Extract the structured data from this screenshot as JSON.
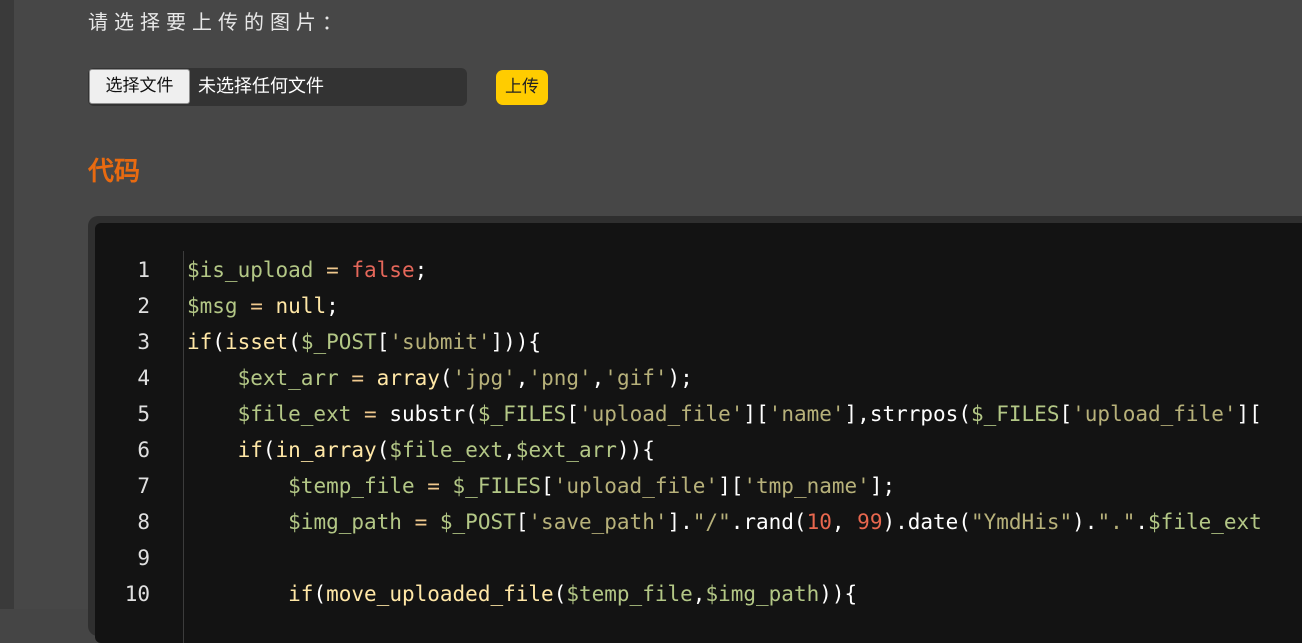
{
  "page": {
    "prompt": "请选择要上传的图片：",
    "section_title": "代码"
  },
  "file_input": {
    "button_label": "选择文件",
    "status_text": "未选择任何文件"
  },
  "upload_button": {
    "label": "上传"
  },
  "colors": {
    "accent_title": "#e86a10",
    "upload_button": "#ffcc00",
    "code_background": "#131313"
  },
  "code": {
    "line_numbers": [
      "1",
      "2",
      "3",
      "4",
      "5",
      "6",
      "7",
      "8",
      "9",
      "10"
    ],
    "lines": [
      [
        {
          "t": "var",
          "v": "$is_upload"
        },
        {
          "t": "op",
          "v": " = "
        },
        {
          "t": "bool",
          "v": "false"
        },
        {
          "t": "fn",
          "v": ";"
        }
      ],
      [
        {
          "t": "var",
          "v": "$msg"
        },
        {
          "t": "op",
          "v": " = "
        },
        {
          "t": "kw",
          "v": "null"
        },
        {
          "t": "fn",
          "v": ";"
        }
      ],
      [
        {
          "t": "kw",
          "v": "if"
        },
        {
          "t": "fn",
          "v": "("
        },
        {
          "t": "kw",
          "v": "isset"
        },
        {
          "t": "fn",
          "v": "("
        },
        {
          "t": "var",
          "v": "$_POST"
        },
        {
          "t": "fn",
          "v": "["
        },
        {
          "t": "str",
          "v": "'submit'"
        },
        {
          "t": "fn",
          "v": "])){"
        }
      ],
      [
        {
          "t": "fn",
          "v": "    "
        },
        {
          "t": "var",
          "v": "$ext_arr"
        },
        {
          "t": "op",
          "v": " = "
        },
        {
          "t": "kw",
          "v": "array"
        },
        {
          "t": "fn",
          "v": "("
        },
        {
          "t": "str",
          "v": "'jpg'"
        },
        {
          "t": "fn",
          "v": ","
        },
        {
          "t": "str",
          "v": "'png'"
        },
        {
          "t": "fn",
          "v": ","
        },
        {
          "t": "str",
          "v": "'gif'"
        },
        {
          "t": "fn",
          "v": ");"
        }
      ],
      [
        {
          "t": "fn",
          "v": "    "
        },
        {
          "t": "var",
          "v": "$file_ext"
        },
        {
          "t": "op",
          "v": " = "
        },
        {
          "t": "fn",
          "v": "substr("
        },
        {
          "t": "var",
          "v": "$_FILES"
        },
        {
          "t": "fn",
          "v": "["
        },
        {
          "t": "str",
          "v": "'upload_file'"
        },
        {
          "t": "fn",
          "v": "]["
        },
        {
          "t": "str",
          "v": "'name'"
        },
        {
          "t": "fn",
          "v": "],strrpos("
        },
        {
          "t": "var",
          "v": "$_FILES"
        },
        {
          "t": "fn",
          "v": "["
        },
        {
          "t": "str",
          "v": "'upload_file'"
        },
        {
          "t": "fn",
          "v": "]["
        }
      ],
      [
        {
          "t": "fn",
          "v": "    "
        },
        {
          "t": "kw",
          "v": "if"
        },
        {
          "t": "fn",
          "v": "("
        },
        {
          "t": "kw",
          "v": "in_array"
        },
        {
          "t": "fn",
          "v": "("
        },
        {
          "t": "var",
          "v": "$file_ext"
        },
        {
          "t": "fn",
          "v": ","
        },
        {
          "t": "var",
          "v": "$ext_arr"
        },
        {
          "t": "fn",
          "v": ")){"
        }
      ],
      [
        {
          "t": "fn",
          "v": "        "
        },
        {
          "t": "var",
          "v": "$temp_file"
        },
        {
          "t": "op",
          "v": " = "
        },
        {
          "t": "var",
          "v": "$_FILES"
        },
        {
          "t": "fn",
          "v": "["
        },
        {
          "t": "str",
          "v": "'upload_file'"
        },
        {
          "t": "fn",
          "v": "]["
        },
        {
          "t": "str",
          "v": "'tmp_name'"
        },
        {
          "t": "fn",
          "v": "];"
        }
      ],
      [
        {
          "t": "fn",
          "v": "        "
        },
        {
          "t": "var",
          "v": "$img_path"
        },
        {
          "t": "op",
          "v": " = "
        },
        {
          "t": "var",
          "v": "$_POST"
        },
        {
          "t": "fn",
          "v": "["
        },
        {
          "t": "str",
          "v": "'save_path'"
        },
        {
          "t": "fn",
          "v": "]."
        },
        {
          "t": "str",
          "v": "\"/\""
        },
        {
          "t": "fn",
          "v": ".rand("
        },
        {
          "t": "num",
          "v": "10"
        },
        {
          "t": "fn",
          "v": ", "
        },
        {
          "t": "num",
          "v": "99"
        },
        {
          "t": "fn",
          "v": ").date("
        },
        {
          "t": "str",
          "v": "\"YmdHis\""
        },
        {
          "t": "fn",
          "v": ")."
        },
        {
          "t": "str",
          "v": "\".\""
        },
        {
          "t": "fn",
          "v": "."
        },
        {
          "t": "var",
          "v": "$file_ext"
        }
      ],
      [],
      [
        {
          "t": "fn",
          "v": "        "
        },
        {
          "t": "kw",
          "v": "if"
        },
        {
          "t": "fn",
          "v": "("
        },
        {
          "t": "kw",
          "v": "move_uploaded_file"
        },
        {
          "t": "fn",
          "v": "("
        },
        {
          "t": "var",
          "v": "$temp_file"
        },
        {
          "t": "fn",
          "v": ","
        },
        {
          "t": "var",
          "v": "$img_path"
        },
        {
          "t": "fn",
          "v": ")){"
        }
      ]
    ]
  }
}
